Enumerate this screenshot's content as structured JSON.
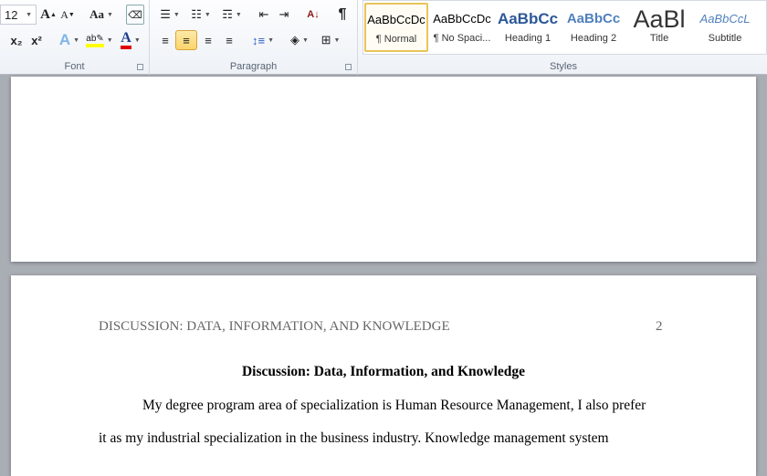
{
  "ribbon": {
    "font": {
      "label": "Font",
      "size": "12",
      "grow": "A",
      "shrink": "A",
      "case": "Aa",
      "subscript": "x₂",
      "superscript": "x²",
      "highlight_color": "#ffff00",
      "font_color": "#e00000"
    },
    "paragraph": {
      "label": "Paragraph",
      "active_alignment": "center",
      "pilcrow": "¶",
      "sort": "A↓"
    },
    "styles": {
      "label": "Styles",
      "items": [
        {
          "sample": "AaBbCcDc",
          "name": "¶ Normal",
          "active": true
        },
        {
          "sample": "AaBbCcDc",
          "name": "¶ No Spaci..."
        },
        {
          "sample": "AaBbCc",
          "name": "Heading 1"
        },
        {
          "sample": "AaBbCc",
          "name": "Heading 2"
        },
        {
          "sample": "AaBl",
          "name": "Title"
        },
        {
          "sample": "AaBbCcL",
          "name": "Subtitle"
        }
      ]
    }
  },
  "document": {
    "header": "DISCUSSION: DATA, INFORMATION, AND KNOWLEDGE",
    "page_number": "2",
    "title": "Discussion: Data, Information, and Knowledge",
    "paragraph_lines": [
      "My degree program area of specialization is Human Resource Management, I also prefer",
      "it as my industrial specialization in the business industry. Knowledge management system"
    ]
  }
}
